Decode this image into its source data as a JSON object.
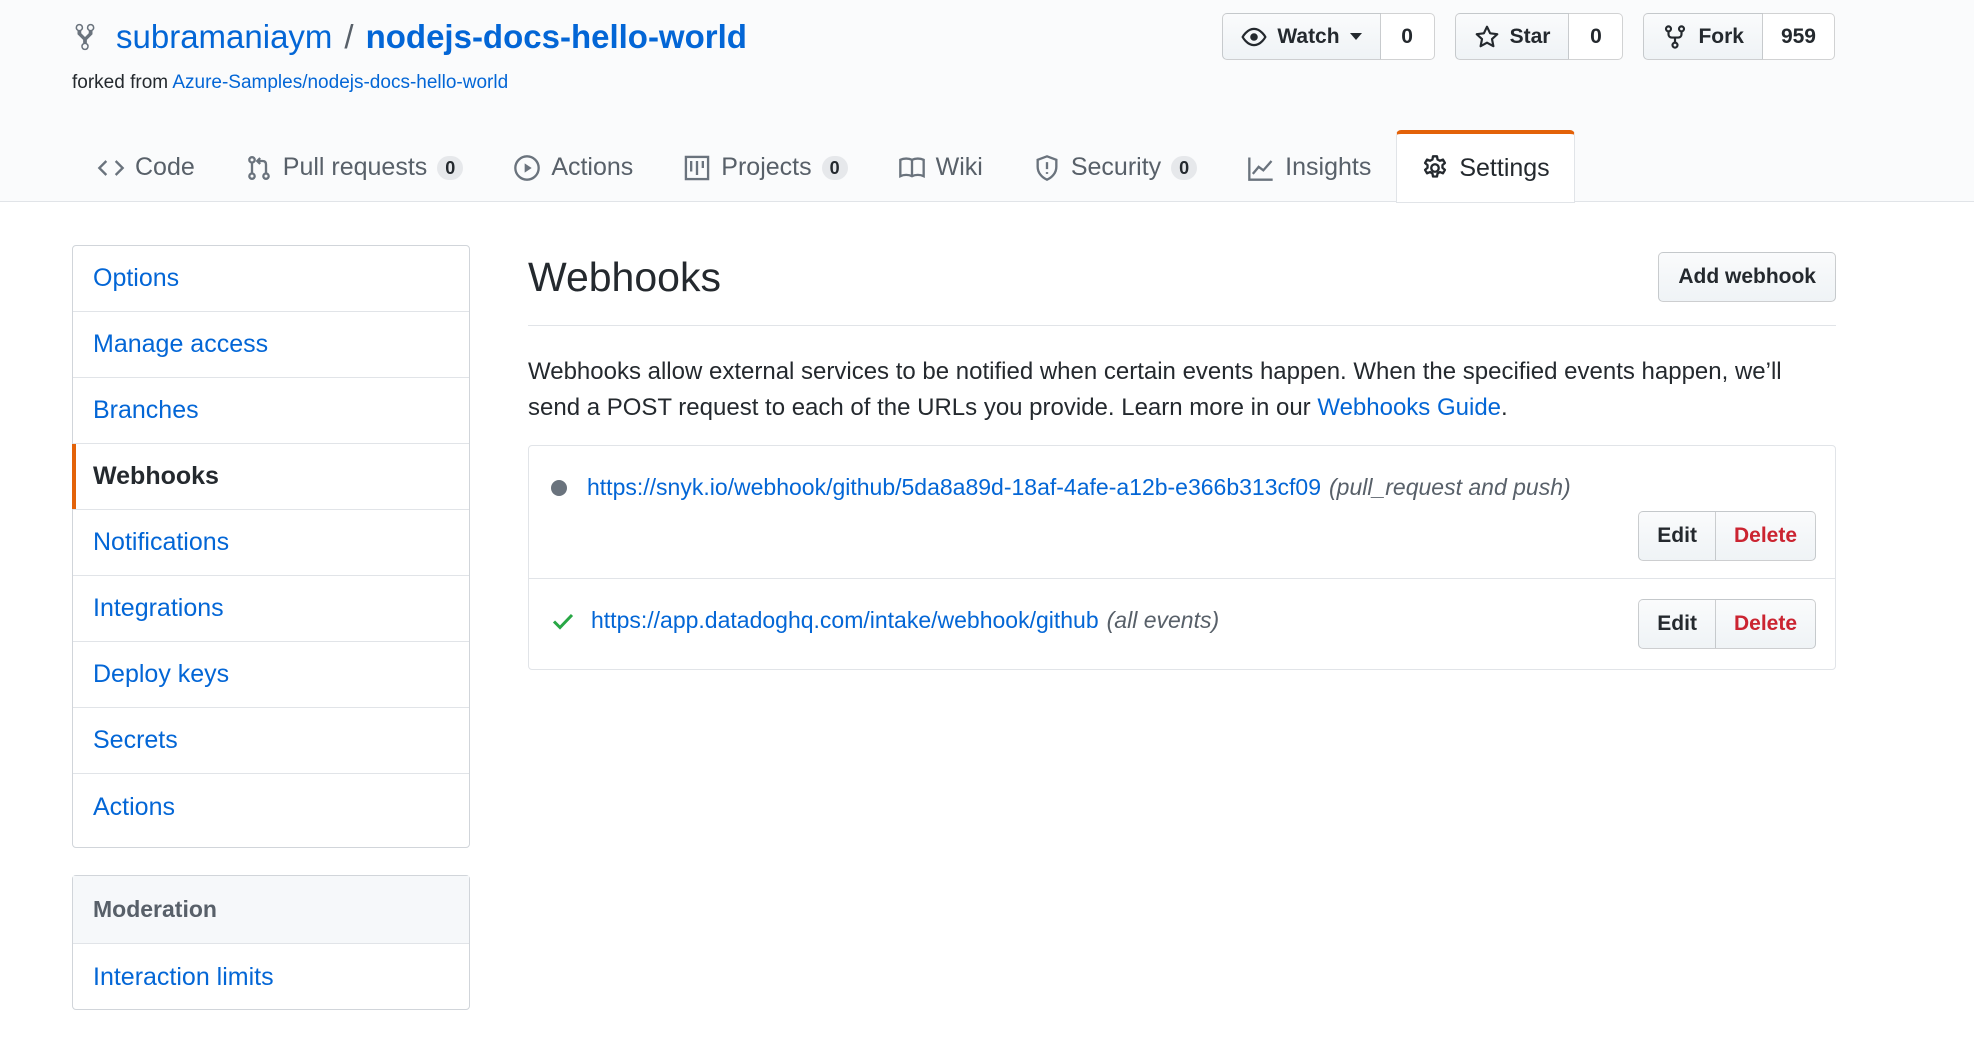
{
  "header": {
    "owner": "subramaniaym",
    "separator": "/",
    "repo": "nodejs-docs-hello-world",
    "forked_prefix": "forked from",
    "forked_source": "Azure-Samples/nodejs-docs-hello-world",
    "icon": "repo-forked-icon"
  },
  "actions": {
    "watch": {
      "label": "Watch",
      "count": "0",
      "icon": "eye-icon"
    },
    "star": {
      "label": "Star",
      "count": "0",
      "icon": "star-icon"
    },
    "fork": {
      "label": "Fork",
      "count": "959",
      "icon": "repo-forked-icon"
    }
  },
  "tabs": [
    {
      "label": "Code",
      "icon": "code-icon"
    },
    {
      "label": "Pull requests",
      "count": "0",
      "icon": "git-pull-request-icon"
    },
    {
      "label": "Actions",
      "icon": "play-icon"
    },
    {
      "label": "Projects",
      "count": "0",
      "icon": "project-icon"
    },
    {
      "label": "Wiki",
      "icon": "book-icon"
    },
    {
      "label": "Security",
      "count": "0",
      "icon": "shield-icon"
    },
    {
      "label": "Insights",
      "icon": "graph-icon"
    },
    {
      "label": "Settings",
      "icon": "gear-icon",
      "selected": true
    }
  ],
  "sidebar": {
    "items": [
      {
        "label": "Options"
      },
      {
        "label": "Manage access"
      },
      {
        "label": "Branches"
      },
      {
        "label": "Webhooks",
        "selected": true
      },
      {
        "label": "Notifications"
      },
      {
        "label": "Integrations"
      },
      {
        "label": "Deploy keys"
      },
      {
        "label": "Secrets"
      },
      {
        "label": "Actions"
      }
    ],
    "moderation": {
      "heading": "Moderation",
      "items": [
        {
          "label": "Interaction limits"
        }
      ]
    }
  },
  "main": {
    "title": "Webhooks",
    "add_button": "Add webhook",
    "description": "Webhooks allow external services to be notified when certain events happen. When the specified events happen, we’ll send a POST request to each of the URLs you provide. Learn more in our",
    "guide_link": "Webhooks Guide",
    "guide_suffix": ".",
    "hooks": [
      {
        "url": "https://snyk.io/webhook/github/5da8a89d-18af-4afe-a12b-e366b313cf09",
        "events": "(pull_request and push)",
        "status": "pending",
        "status_icon": "dot-icon",
        "edit": "Edit",
        "delete": "Delete"
      },
      {
        "url": "https://app.datadoghq.com/intake/webhook/github",
        "events": "(all events)",
        "status": "success",
        "status_icon": "check-icon",
        "edit": "Edit",
        "delete": "Delete"
      }
    ]
  },
  "colors": {
    "link": "#0366d6",
    "accent": "#e36209",
    "danger": "#cb2431",
    "success": "#28a745",
    "muted": "#586069"
  }
}
